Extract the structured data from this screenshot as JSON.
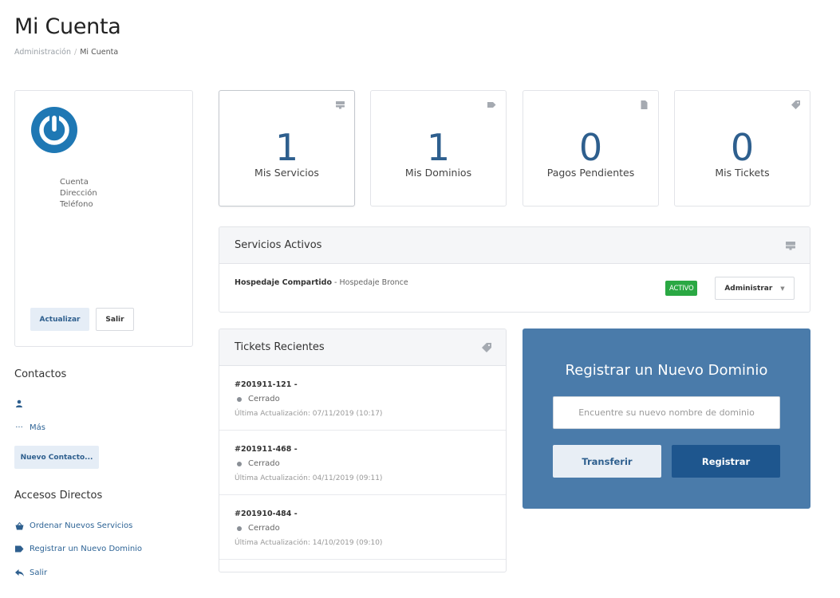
{
  "page": {
    "title": "Mi Cuenta",
    "breadcrumb": [
      "Administración",
      "Mi Cuenta"
    ]
  },
  "profile": {
    "fields": [
      "Cuenta",
      "Dirección",
      "Teléfono"
    ],
    "update_label": "Actualizar",
    "logout_label": "Salir",
    "logo_color": "#1f78b4"
  },
  "contacts": {
    "heading": "Contactos",
    "more_label": "Más",
    "new_contact_label": "Nuevo Contacto..."
  },
  "shortcuts": {
    "heading": "Accesos Directos",
    "items": [
      {
        "label": "Ordenar Nuevos Servicios",
        "icon": "basket-icon"
      },
      {
        "label": "Registrar un Nuevo Dominio",
        "icon": "tag-icon"
      },
      {
        "label": "Salir",
        "icon": "back-arrow-icon"
      }
    ]
  },
  "tiles": [
    {
      "count": "1",
      "label": "Mis Servicios",
      "icon": "server-icon"
    },
    {
      "count": "1",
      "label": "Mis Dominios",
      "icon": "tag-icon"
    },
    {
      "count": "0",
      "label": "Pagos Pendientes",
      "icon": "document-icon"
    },
    {
      "count": "0",
      "label": "Mis Tickets",
      "icon": "ticket-icon"
    }
  ],
  "active_services": {
    "title": "Servicios Activos",
    "icon": "server-icon",
    "items": [
      {
        "product": "Hospedaje Compartido",
        "separator": " - ",
        "plan": "Hospedaje Bronce",
        "status": "ACTIVO",
        "action_label": "Administrar"
      }
    ]
  },
  "recent_tickets": {
    "title": "Tickets Recientes",
    "icon": "ticket-icon",
    "items": [
      {
        "id": "#201911-121 -",
        "status": "Cerrado",
        "updated": "Última Actualización: 07/11/2019 (10:17)"
      },
      {
        "id": "#201911-468 -",
        "status": "Cerrado",
        "updated": "Última Actualización: 04/11/2019 (09:11)"
      },
      {
        "id": "#201910-484 -",
        "status": "Cerrado",
        "updated": "Última Actualización: 14/10/2019 (09:10)"
      }
    ]
  },
  "domain_register": {
    "title": "Registrar un Nuevo Dominio",
    "placeholder": "Encuentre su nuevo nombre de dominio",
    "transfer_label": "Transferir",
    "register_label": "Registrar"
  },
  "colors": {
    "accent": "#2e5f8e",
    "active_badge": "#2aa843",
    "domain_box": "#4a7baa",
    "register_button": "#1e568e"
  }
}
